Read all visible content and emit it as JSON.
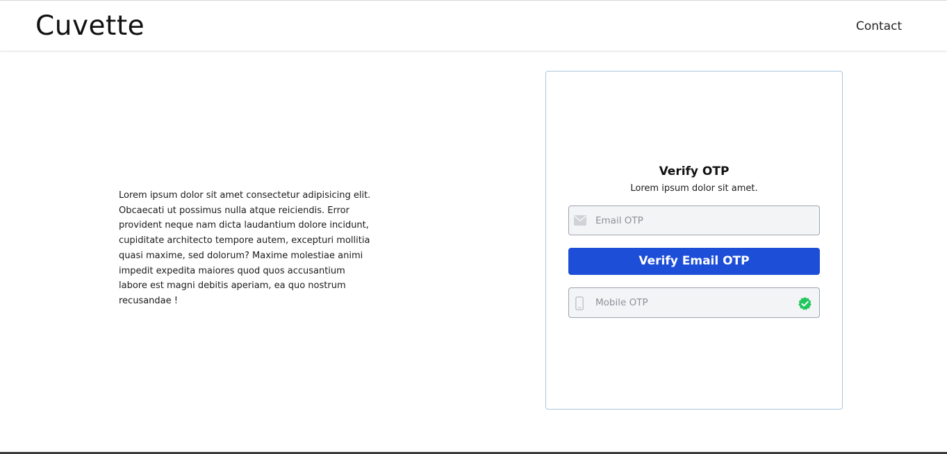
{
  "header": {
    "brand": "Cuvette",
    "nav": {
      "contact_label": "Contact"
    }
  },
  "intro": {
    "text": "Lorem ipsum dolor sit amet consectetur adipisicing elit. Obcaecati ut possimus nulla atque reiciendis. Error provident neque nam dicta laudantium dolore incidunt, cupiditate architecto tempore autem, excepturi mollitia quasi maxime, sed dolorum? Maxime molestiae animi impedit expedita maiores quod quos accusantium labore est magni debitis aperiam, ea quo nostrum recusandae !"
  },
  "verify_card": {
    "title": "Verify OTP",
    "subtitle": "Lorem ipsum dolor sit amet.",
    "email_otp": {
      "placeholder": "Email OTP",
      "value": "",
      "icon": "mail-icon"
    },
    "verify_button_label": "Verify Email OTP",
    "mobile_otp": {
      "placeholder": "Mobile OTP",
      "value": "",
      "icon": "phone-icon",
      "status_icon": "verified-check-icon"
    }
  },
  "colors": {
    "primary_button": "#1d4ed8",
    "card_border": "#a9c7de",
    "verified_green": "#22c55e",
    "field_bg": "#f3f4f6"
  }
}
